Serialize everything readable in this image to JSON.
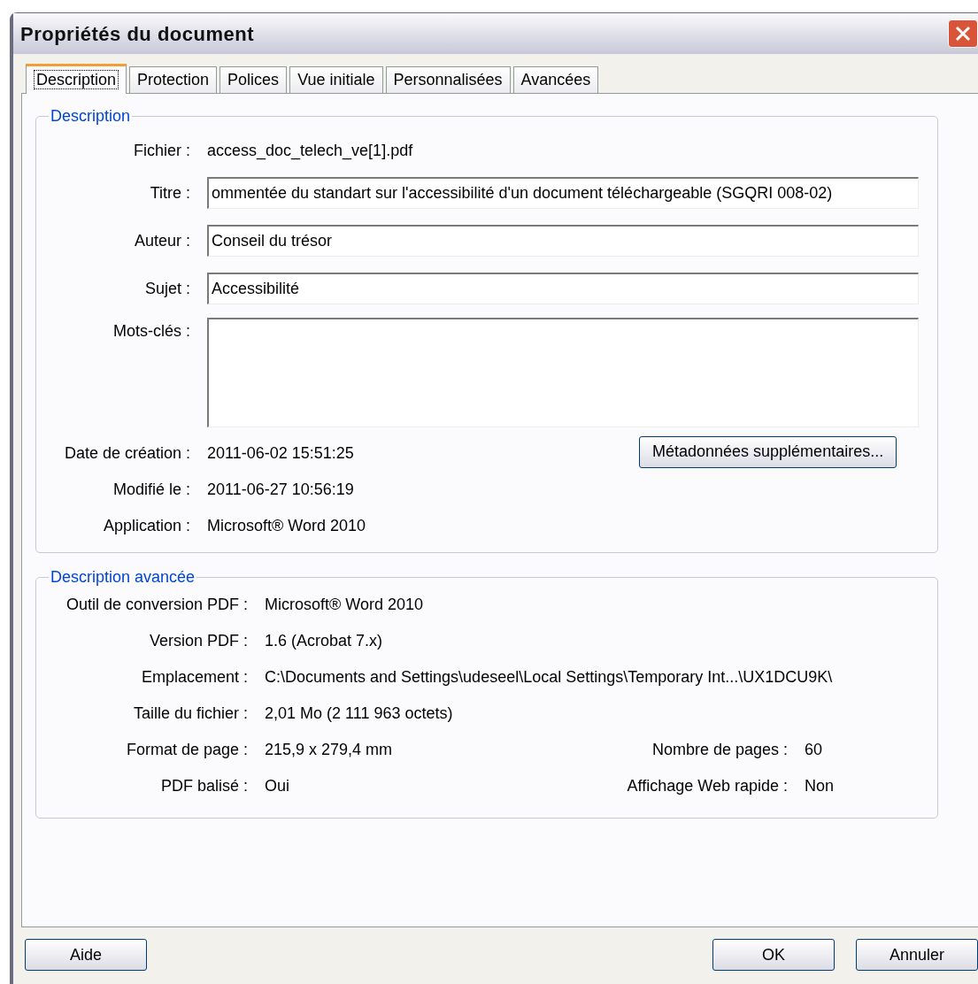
{
  "window": {
    "title": "Propriétés du document"
  },
  "tabs": [
    {
      "label": "Description",
      "selected": true
    },
    {
      "label": "Protection",
      "selected": false
    },
    {
      "label": "Polices",
      "selected": false
    },
    {
      "label": "Vue initiale",
      "selected": false
    },
    {
      "label": "Personnalisées",
      "selected": false
    },
    {
      "label": "Avancées",
      "selected": false
    }
  ],
  "description": {
    "legend": "Description",
    "fields": [
      {
        "kind": "text",
        "label": "Fichier :",
        "value": "access_doc_telech_ve[1].pdf"
      },
      {
        "kind": "input",
        "label": "Titre :",
        "value": "ommentée du standart sur l'accessibilité d'un document téléchargeable (SGQRI 008-02)"
      },
      {
        "kind": "input",
        "label": "Auteur :",
        "value": "Conseil du trésor"
      },
      {
        "kind": "input",
        "label": "Sujet :",
        "value": "Accessibilité"
      },
      {
        "kind": "textarea",
        "label": "Mots-clés :"
      }
    ],
    "dates": [
      {
        "label": "Date de création :",
        "value": "2011-06-02 15:51:25"
      },
      {
        "label": "Modifié le :",
        "value": "2011-06-27 10:56:19"
      },
      {
        "label": "Application :",
        "value": "Microsoft® Word 2010"
      }
    ],
    "metadata_button": "Métadonnées supplémentaires..."
  },
  "advanced": {
    "legend": "Description avancée",
    "rows": [
      {
        "label": "Outil de conversion PDF :",
        "value": "Microsoft® Word 2010"
      },
      {
        "label": "Version PDF :",
        "value": "1.6 (Acrobat 7.x)"
      },
      {
        "label": "Emplacement :",
        "value": "C:\\Documents and Settings\\udeseel\\Local Settings\\Temporary Int...\\UX1DCU9K\\"
      },
      {
        "label": "Taille du fichier :",
        "value": "2,01 Mo (2 111 963 octets)"
      },
      {
        "label": "Format de page :",
        "value": "215,9 x 279,4 mm",
        "label2": "Nombre de pages :",
        "value2": "60"
      },
      {
        "label": "PDF balisé :",
        "value": "Oui",
        "label2": "Affichage Web rapide :",
        "value2": "Non"
      }
    ]
  },
  "buttons": {
    "help": "Aide",
    "ok": "OK",
    "cancel": "Annuler"
  }
}
